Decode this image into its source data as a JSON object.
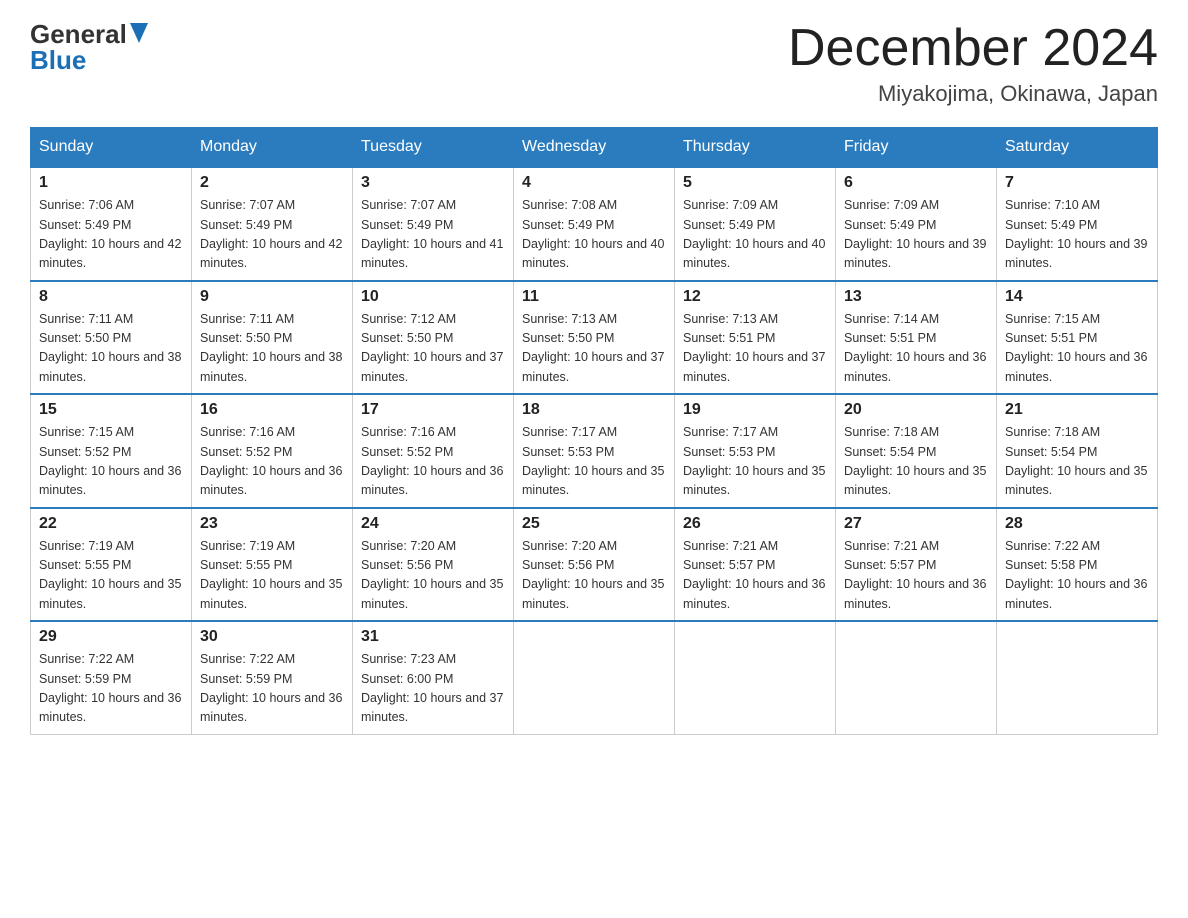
{
  "header": {
    "logo_general": "General",
    "logo_blue": "Blue",
    "month_title": "December 2024",
    "location": "Miyakojima, Okinawa, Japan"
  },
  "days_of_week": [
    "Sunday",
    "Monday",
    "Tuesday",
    "Wednesday",
    "Thursday",
    "Friday",
    "Saturday"
  ],
  "weeks": [
    [
      {
        "day": "1",
        "sunrise": "7:06 AM",
        "sunset": "5:49 PM",
        "daylight": "10 hours and 42 minutes."
      },
      {
        "day": "2",
        "sunrise": "7:07 AM",
        "sunset": "5:49 PM",
        "daylight": "10 hours and 42 minutes."
      },
      {
        "day": "3",
        "sunrise": "7:07 AM",
        "sunset": "5:49 PM",
        "daylight": "10 hours and 41 minutes."
      },
      {
        "day": "4",
        "sunrise": "7:08 AM",
        "sunset": "5:49 PM",
        "daylight": "10 hours and 40 minutes."
      },
      {
        "day": "5",
        "sunrise": "7:09 AM",
        "sunset": "5:49 PM",
        "daylight": "10 hours and 40 minutes."
      },
      {
        "day": "6",
        "sunrise": "7:09 AM",
        "sunset": "5:49 PM",
        "daylight": "10 hours and 39 minutes."
      },
      {
        "day": "7",
        "sunrise": "7:10 AM",
        "sunset": "5:49 PM",
        "daylight": "10 hours and 39 minutes."
      }
    ],
    [
      {
        "day": "8",
        "sunrise": "7:11 AM",
        "sunset": "5:50 PM",
        "daylight": "10 hours and 38 minutes."
      },
      {
        "day": "9",
        "sunrise": "7:11 AM",
        "sunset": "5:50 PM",
        "daylight": "10 hours and 38 minutes."
      },
      {
        "day": "10",
        "sunrise": "7:12 AM",
        "sunset": "5:50 PM",
        "daylight": "10 hours and 37 minutes."
      },
      {
        "day": "11",
        "sunrise": "7:13 AM",
        "sunset": "5:50 PM",
        "daylight": "10 hours and 37 minutes."
      },
      {
        "day": "12",
        "sunrise": "7:13 AM",
        "sunset": "5:51 PM",
        "daylight": "10 hours and 37 minutes."
      },
      {
        "day": "13",
        "sunrise": "7:14 AM",
        "sunset": "5:51 PM",
        "daylight": "10 hours and 36 minutes."
      },
      {
        "day": "14",
        "sunrise": "7:15 AM",
        "sunset": "5:51 PM",
        "daylight": "10 hours and 36 minutes."
      }
    ],
    [
      {
        "day": "15",
        "sunrise": "7:15 AM",
        "sunset": "5:52 PM",
        "daylight": "10 hours and 36 minutes."
      },
      {
        "day": "16",
        "sunrise": "7:16 AM",
        "sunset": "5:52 PM",
        "daylight": "10 hours and 36 minutes."
      },
      {
        "day": "17",
        "sunrise": "7:16 AM",
        "sunset": "5:52 PM",
        "daylight": "10 hours and 36 minutes."
      },
      {
        "day": "18",
        "sunrise": "7:17 AM",
        "sunset": "5:53 PM",
        "daylight": "10 hours and 35 minutes."
      },
      {
        "day": "19",
        "sunrise": "7:17 AM",
        "sunset": "5:53 PM",
        "daylight": "10 hours and 35 minutes."
      },
      {
        "day": "20",
        "sunrise": "7:18 AM",
        "sunset": "5:54 PM",
        "daylight": "10 hours and 35 minutes."
      },
      {
        "day": "21",
        "sunrise": "7:18 AM",
        "sunset": "5:54 PM",
        "daylight": "10 hours and 35 minutes."
      }
    ],
    [
      {
        "day": "22",
        "sunrise": "7:19 AM",
        "sunset": "5:55 PM",
        "daylight": "10 hours and 35 minutes."
      },
      {
        "day": "23",
        "sunrise": "7:19 AM",
        "sunset": "5:55 PM",
        "daylight": "10 hours and 35 minutes."
      },
      {
        "day": "24",
        "sunrise": "7:20 AM",
        "sunset": "5:56 PM",
        "daylight": "10 hours and 35 minutes."
      },
      {
        "day": "25",
        "sunrise": "7:20 AM",
        "sunset": "5:56 PM",
        "daylight": "10 hours and 35 minutes."
      },
      {
        "day": "26",
        "sunrise": "7:21 AM",
        "sunset": "5:57 PM",
        "daylight": "10 hours and 36 minutes."
      },
      {
        "day": "27",
        "sunrise": "7:21 AM",
        "sunset": "5:57 PM",
        "daylight": "10 hours and 36 minutes."
      },
      {
        "day": "28",
        "sunrise": "7:22 AM",
        "sunset": "5:58 PM",
        "daylight": "10 hours and 36 minutes."
      }
    ],
    [
      {
        "day": "29",
        "sunrise": "7:22 AM",
        "sunset": "5:59 PM",
        "daylight": "10 hours and 36 minutes."
      },
      {
        "day": "30",
        "sunrise": "7:22 AM",
        "sunset": "5:59 PM",
        "daylight": "10 hours and 36 minutes."
      },
      {
        "day": "31",
        "sunrise": "7:23 AM",
        "sunset": "6:00 PM",
        "daylight": "10 hours and 37 minutes."
      },
      null,
      null,
      null,
      null
    ]
  ],
  "labels": {
    "sunrise_prefix": "Sunrise: ",
    "sunset_prefix": "Sunset: ",
    "daylight_prefix": "Daylight: "
  }
}
